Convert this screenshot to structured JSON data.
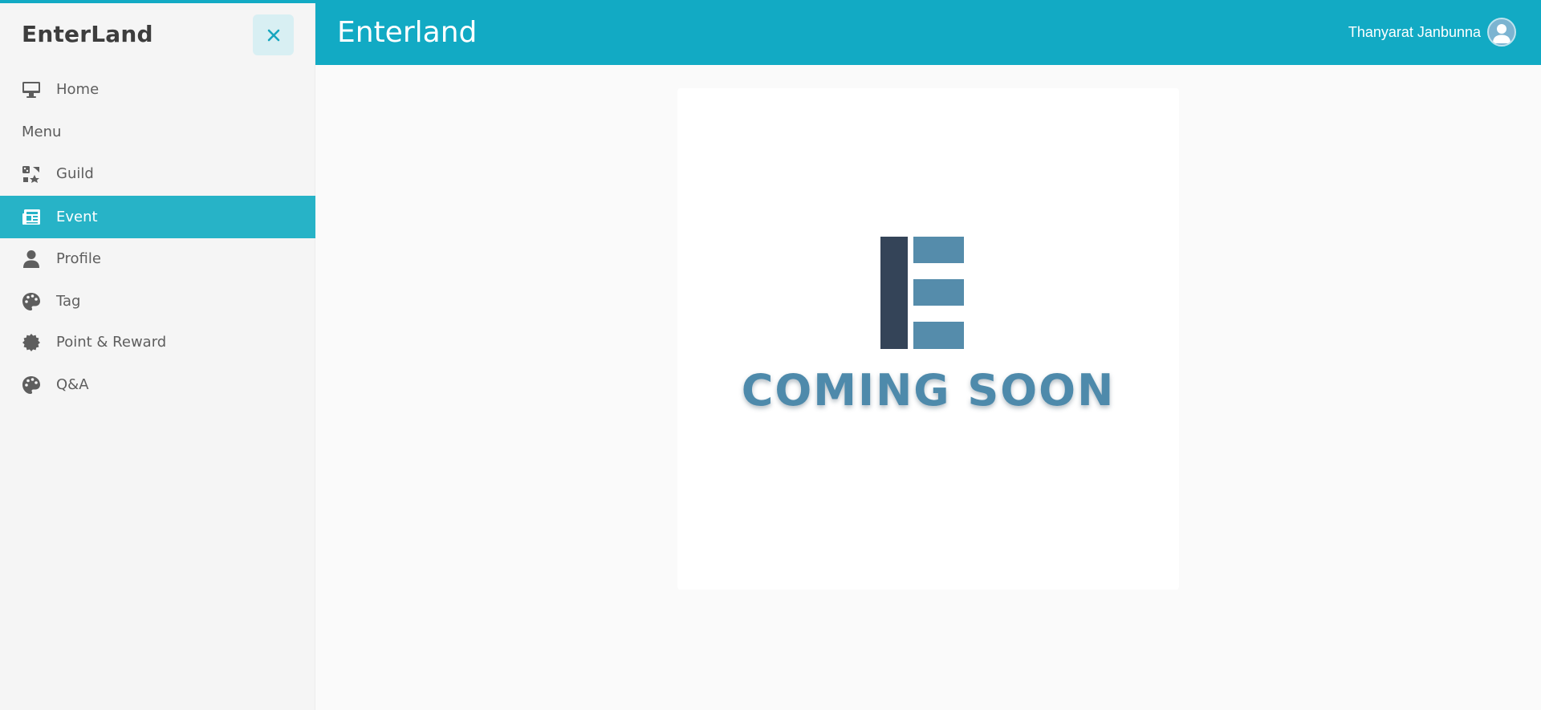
{
  "sidebar": {
    "brand": "EnterLand",
    "close_icon": "close-icon",
    "menu_heading": "Menu",
    "items": [
      {
        "label": "Home",
        "icon": "desktop-icon"
      },
      {
        "label": "Guild",
        "icon": "guild-icon"
      },
      {
        "label": "Event",
        "icon": "newspaper-icon",
        "active": true
      },
      {
        "label": "Profile",
        "icon": "user-icon"
      },
      {
        "label": "Tag",
        "icon": "palette-icon"
      },
      {
        "label": "Point & Reward",
        "icon": "badge-icon"
      },
      {
        "label": "Q&A",
        "icon": "palette-icon"
      }
    ]
  },
  "header": {
    "title": "Enterland",
    "user_name": "Thanyarat Janbunna",
    "avatar_icon": "avatar-icon"
  },
  "main": {
    "coming_soon": "COMING SOON",
    "logo_icon": "enterland-logo"
  },
  "colors": {
    "accent": "#12aac4",
    "active_item": "#27b3c7",
    "logo_dark": "#344458",
    "logo_light": "#558cab"
  }
}
